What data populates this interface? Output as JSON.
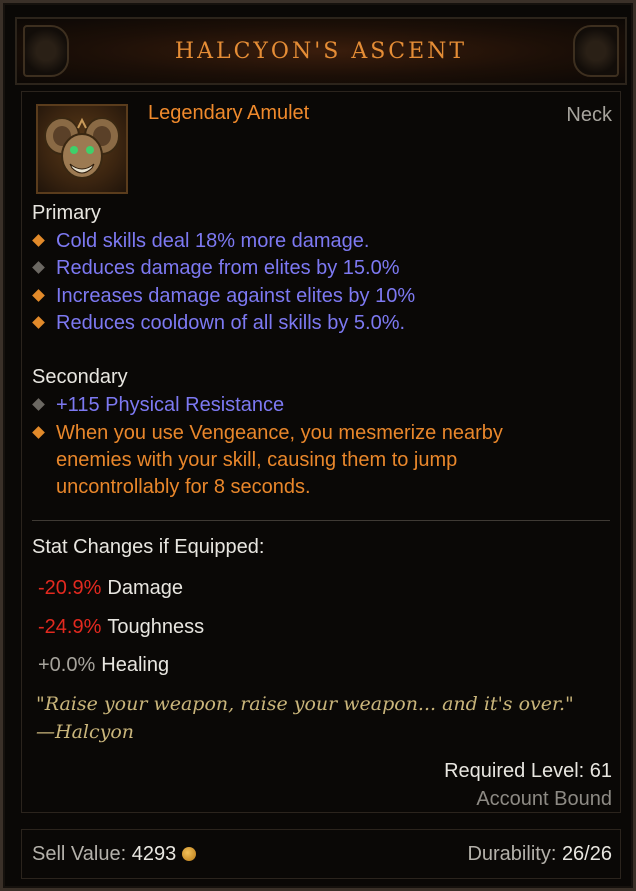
{
  "tooltip": {
    "title": "HALCYON'S ASCENT",
    "item_type": "Legendary Amulet",
    "slot": "Neck",
    "icon": "amulet-icon",
    "primary": {
      "heading": "Primary",
      "affixes": [
        {
          "text": "Cold skills deal 18% more damage.",
          "bullet": "orange",
          "color": "#7d79f2"
        },
        {
          "text": "Reduces damage from elites by 15.0%",
          "bullet": "gray",
          "color": "#7d79f2"
        },
        {
          "text": "Increases damage against elites by 10%",
          "bullet": "orange",
          "color": "#7d79f2"
        },
        {
          "text": "Reduces cooldown of all skills by 5.0%.",
          "bullet": "orange",
          "color": "#7d79f2"
        }
      ]
    },
    "secondary": {
      "heading": "Secondary",
      "affixes": [
        {
          "text": "+115 Physical Resistance",
          "bullet": "gray",
          "color": "#7d79f2"
        },
        {
          "text": "When you use Vengeance, you mesmerize nearby enemies with your skill, causing them to jump uncontrollably for 8 seconds.",
          "bullet": "orange",
          "color": "#e9872b"
        }
      ]
    },
    "stat_changes": {
      "heading": "Stat Changes if Equipped:",
      "rows": [
        {
          "value": "-20.9%",
          "label": "Damage"
        },
        {
          "value": "-24.9%",
          "label": "Toughness"
        },
        {
          "value": "+0.0%",
          "label": "Healing"
        }
      ]
    },
    "flavor": {
      "line1": "\"Raise your weapon, raise your weapon... and it's over.\"",
      "line2": "—Halcyon"
    },
    "required_level": "Required Level: 61",
    "binding": "Account Bound",
    "footer": {
      "sell_label": "Sell Value:",
      "sell_value": "4293",
      "durability_label": "Durability:",
      "durability_value": "26/26"
    }
  },
  "colors": {
    "legendary_orange": "#f08a2c",
    "magic_blue": "#7d79f2",
    "negative_red": "#e3291f",
    "flavor_gold": "#c9b57b"
  }
}
